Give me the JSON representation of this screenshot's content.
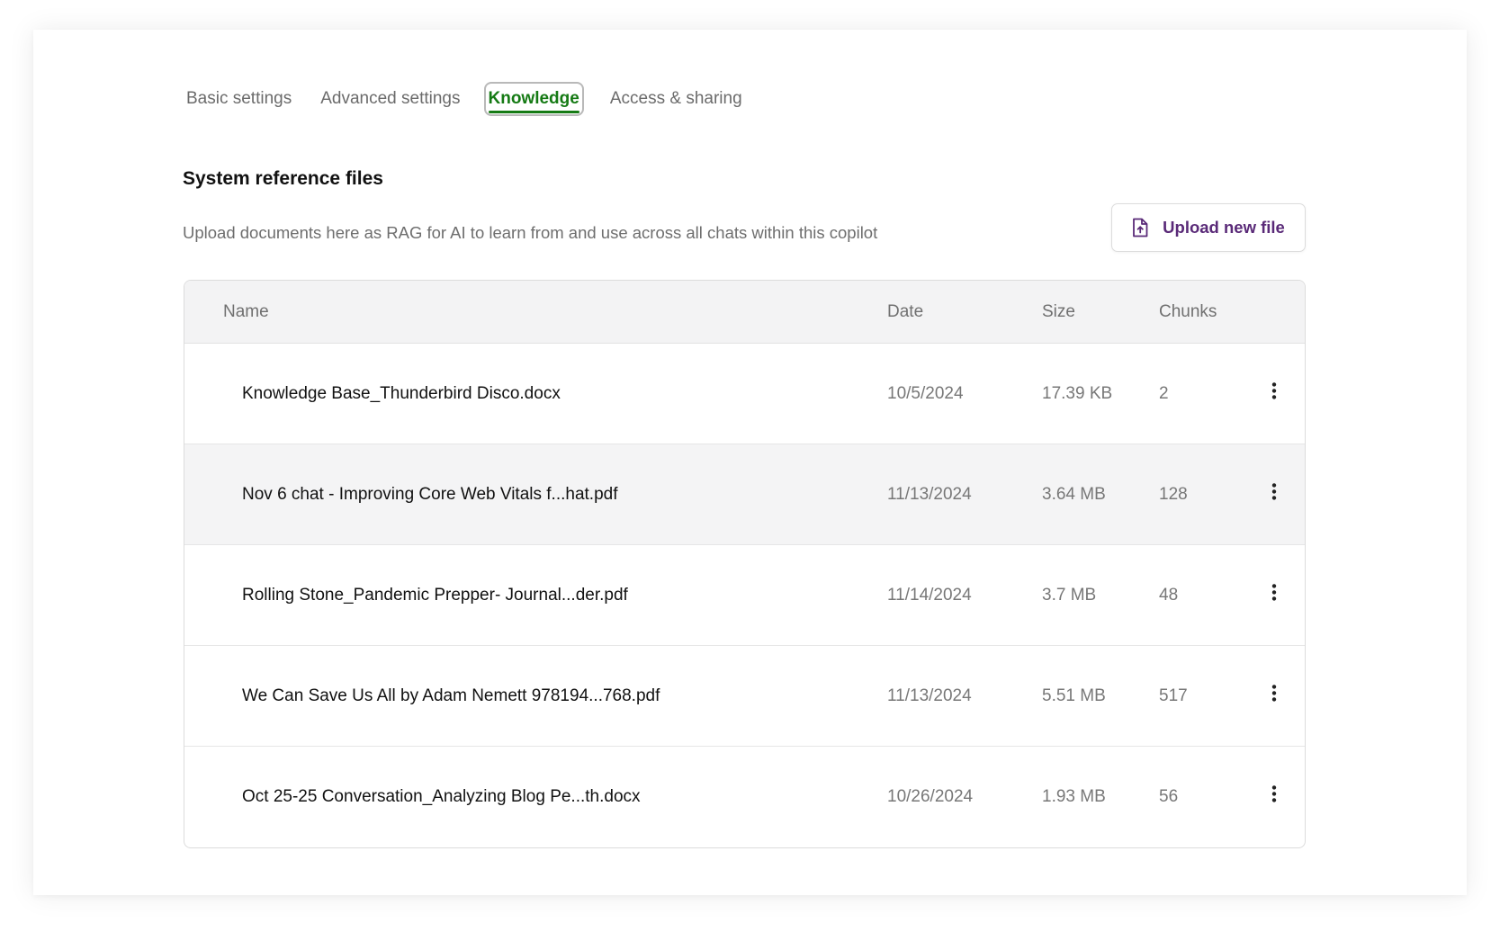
{
  "tabs": [
    {
      "label": "Basic settings",
      "active": false
    },
    {
      "label": "Advanced settings",
      "active": false
    },
    {
      "label": "Knowledge",
      "active": true
    },
    {
      "label": "Access & sharing",
      "active": false
    }
  ],
  "section": {
    "title": "System reference files",
    "description": "Upload documents here as RAG for AI to learn from and use across all chats within this copilot"
  },
  "upload_button": {
    "label": "Upload new file",
    "icon": "file-upload-icon"
  },
  "table": {
    "headers": {
      "name": "Name",
      "date": "Date",
      "size": "Size",
      "chunks": "Chunks"
    },
    "rows": [
      {
        "name": "Knowledge Base_Thunderbird Disco.docx",
        "date": "10/5/2024",
        "size": "17.39 KB",
        "chunks": "2"
      },
      {
        "name": "Nov 6 chat - Improving Core Web Vitals f...hat.pdf",
        "date": "11/13/2024",
        "size": "3.64 MB",
        "chunks": "128"
      },
      {
        "name": "Rolling Stone_Pandemic Prepper- Journal...der.pdf",
        "date": "11/14/2024",
        "size": "3.7 MB",
        "chunks": "48"
      },
      {
        "name": "We Can Save Us All by Adam Nemett 978194...768.pdf",
        "date": "11/13/2024",
        "size": "5.51 MB",
        "chunks": "517"
      },
      {
        "name": "Oct 25-25 Conversation_Analyzing Blog Pe...th.docx",
        "date": "10/26/2024",
        "size": "1.93 MB",
        "chunks": "56"
      }
    ]
  },
  "colors": {
    "accent_green": "#157a14",
    "button_purple": "#5a2a78"
  }
}
